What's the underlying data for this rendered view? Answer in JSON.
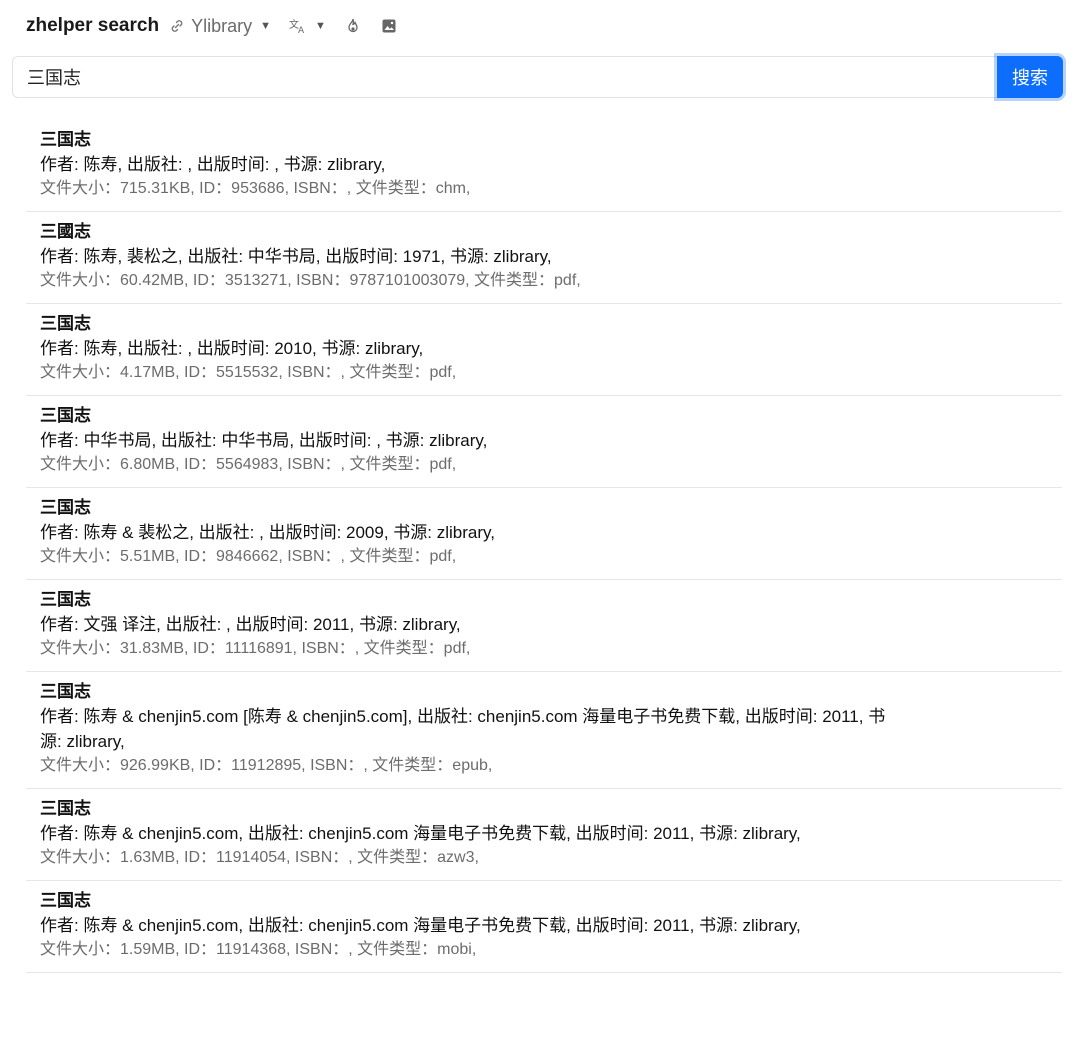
{
  "header": {
    "brand": "zhelper search",
    "library_label": "Ylibrary",
    "icons": [
      "link-icon",
      "translate-icon",
      "fire-icon",
      "image-icon"
    ]
  },
  "search": {
    "value": "三国志",
    "button_label": "搜索"
  },
  "accent_color": "#0d6efd",
  "results": [
    {
      "title": "三国志",
      "meta": "作者: 陈寿, 出版社: , 出版时间: , 书源: zlibrary,",
      "info": "文件大小：715.31KB, ID：953686, ISBN：, 文件类型：chm,"
    },
    {
      "title": "三國志",
      "meta": "作者: 陈寿, 裴松之, 出版社: 中华书局, 出版时间: 1971, 书源: zlibrary,",
      "info": "文件大小：60.42MB, ID：3513271, ISBN：9787101003079, 文件类型：pdf,"
    },
    {
      "title": "三国志",
      "meta": "作者: 陈寿, 出版社: , 出版时间: 2010, 书源: zlibrary,",
      "info": "文件大小：4.17MB, ID：5515532, ISBN：, 文件类型：pdf,"
    },
    {
      "title": "三国志",
      "meta": "作者: 中华书局, 出版社: 中华书局, 出版时间: , 书源: zlibrary,",
      "info": "文件大小：6.80MB, ID：5564983, ISBN：, 文件类型：pdf,"
    },
    {
      "title": "三国志",
      "meta": "作者: 陈寿 & 裴松之, 出版社: , 出版时间: 2009, 书源: zlibrary,",
      "info": "文件大小：5.51MB, ID：9846662, ISBN：, 文件类型：pdf,"
    },
    {
      "title": "三国志",
      "meta": "作者: 文强 译注, 出版社: , 出版时间: 2011, 书源: zlibrary,",
      "info": "文件大小：31.83MB, ID：11116891, ISBN：, 文件类型：pdf,"
    },
    {
      "title": "三国志",
      "meta": "作者: 陈寿 & chenjin5.com [陈寿 & chenjin5.com], 出版社: chenjin5.com 海量电子书免费下载, 出版时间: 2011, 书源: zlibrary,",
      "info": "文件大小：926.99KB, ID：11912895, ISBN：, 文件类型：epub,"
    },
    {
      "title": "三国志",
      "meta": "作者: 陈寿 & chenjin5.com, 出版社: chenjin5.com 海量电子书免费下载, 出版时间: 2011, 书源: zlibrary,",
      "info": "文件大小：1.63MB, ID：11914054, ISBN：, 文件类型：azw3,"
    },
    {
      "title": "三国志",
      "meta": "作者: 陈寿 & chenjin5.com, 出版社: chenjin5.com 海量电子书免费下载, 出版时间: 2011, 书源: zlibrary,",
      "info": "文件大小：1.59MB, ID：11914368, ISBN：, 文件类型：mobi,"
    }
  ]
}
